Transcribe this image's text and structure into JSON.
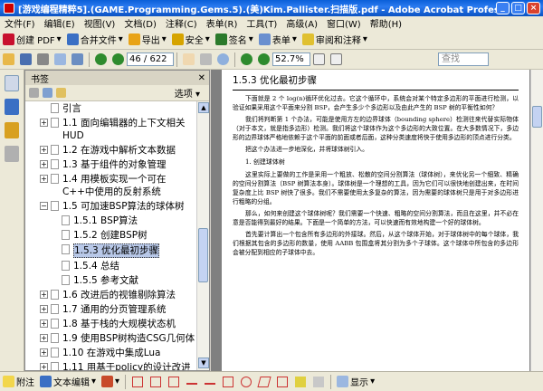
{
  "window": {
    "title": "[游戏编程精粹5].(GAME.Programming.Gems.5).(美)Kim.Pallister.扫描版.pdf - Adobe Acrobat Professional",
    "buttons": [
      "_",
      "□",
      "×"
    ]
  },
  "menu": [
    "文件(F)",
    "编辑(E)",
    "视图(V)",
    "文档(D)",
    "注释(C)",
    "表单(R)",
    "工具(T)",
    "高级(A)",
    "窗口(W)",
    "帮助(H)"
  ],
  "toolbar1": {
    "create_pdf": "创建 PDF",
    "combine": "合并文件",
    "export": "导出",
    "secure": "安全",
    "sign": "签名",
    "forms": "表单",
    "review": "审阅和注释"
  },
  "toolbar2": {
    "page_value": "46 / 622",
    "zoom_value": "52.7%",
    "search_placeholder": "查找"
  },
  "bookmarks": {
    "header": "书签",
    "options": "选项",
    "items": [
      {
        "label": "引言",
        "level": 1
      },
      {
        "label": "1.1 面向编辑器的上下文相关HUD",
        "level": 1
      },
      {
        "label": "1.2 在游戏中解析文本数据",
        "level": 1
      },
      {
        "label": "1.3 基于组件的对象管理",
        "level": 1
      },
      {
        "label": "1.4 用模板实现一个可在C++中使用的反射系统",
        "level": 1
      },
      {
        "label": "1.5 可加速BSP算法的球体树",
        "level": 1
      },
      {
        "label": "1.5.1 BSP算法",
        "level": 2
      },
      {
        "label": "1.5.2 创建BSP树",
        "level": 2
      },
      {
        "label": "1.5.3 优化最初步骤",
        "level": 2,
        "selected": true
      },
      {
        "label": "1.5.4 总结",
        "level": 2
      },
      {
        "label": "1.5.5 参考文献",
        "level": 2
      },
      {
        "label": "1.6 改进后的视锥剔除算法",
        "level": 1
      },
      {
        "label": "1.7 通用的分页管理系统",
        "level": 1
      },
      {
        "label": "1.8 基于栈的大规模状态机",
        "level": 1
      },
      {
        "label": "1.9 使用BSP树构造CSG几何体",
        "level": 1
      },
      {
        "label": "1.10 在游戏中集成Lua",
        "level": 1
      },
      {
        "label": "1.11 用基于policy的设计改进Freelist",
        "level": 1
      }
    ]
  },
  "document": {
    "section_title": "1.5.3   优化最初步骤",
    "paragraphs": [
      "下面就是 2 个 log(n)循环优化过去。它这个循环中，系统会对某个特定多边形的平面进行检测，以验证如果采用这个平面来分割 BSP，会产生多少个多边形以及由此产生的 BSP 树的平衡性如何？",
      "我们将判断第 1 个办法，可能是使用方左的边界球体（bounding sphere）检测往来代替实际物体（对于本文，就是指多边形）检测。我们将这个球体作为这个多边形的大致位置。在大多数情况下，多边形的边界球体严格地依赖于这个平面的前面或者后面，这种分类速度将快于使用多边形的顶点进行分类。",
      "把这个办法进一步地深化，并将球体树引入。"
    ],
    "subhead": "1. 创建球体树",
    "paragraphs2": [
      "这里实际上要做的工作是采用一个粗放、松散的空间分割算法（球体树），来优化另一个细致、精确的空间分割算法（BSP 树算法本身）。球体树是一个理想的工具，因为它们可以很快地创建出来，在时间复杂度上比 BSP 树快了很多。我们不需要使用太多复杂的算法，因为需要的球体树只是用于对多边形进行粗略的分组。",
      "那么，如何来创建这个球体树呢？我们需要一个快速、粗略的空间分割算法，而且在这里，并不必在意是否能得到最好的结果。下面是一个简单的方法，可以快速而有效地构建一个好的球体树。",
      "首先要计算出一个包含所有多边形的外接球。然后，从这个球体开始，对于球体树中的每个球体，我们根据其包含的多边形的数量，使用 AABB 包围盒将其分割为多个子球体。这个球体中所包含的多边形会被分配到相应的子球体中去。"
    ]
  },
  "bottombar": {
    "attach": "附注",
    "textedit": "文本编辑",
    "show": "显示"
  },
  "colors": {
    "titlebar": "#0a5fd8",
    "chrome": "#ece9d8",
    "selection": "#b8c8e8"
  }
}
